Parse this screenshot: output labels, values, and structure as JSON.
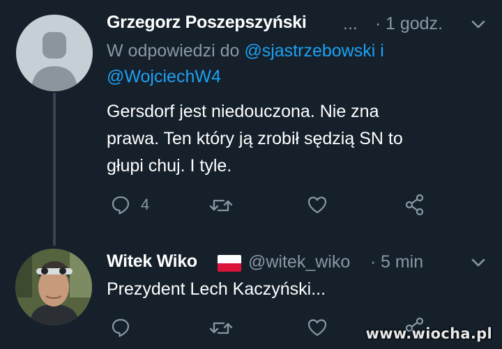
{
  "tweet1": {
    "author_name": "Grzegorz Poszepszyński",
    "ellipsis": "...",
    "dot": "·",
    "time": "1 godz.",
    "reply_prefix": "W odpowiedzi do",
    "mention1": "@sjastrzebowski",
    "conj": "i",
    "mention2": "@WojciechW4",
    "text_line1": "Gersdorf jest niedouczona. Nie zna",
    "text_line2": "prawa. Ten który ją zrobił sędzią SN to",
    "text_line3": "głupi chuj. I tyle.",
    "reply_count": "4"
  },
  "tweet2": {
    "author_name": "Witek Wiko",
    "handle": "@witek_wiko",
    "dot": "·",
    "time": "5 min",
    "text": "Prezydent Lech Kaczyński..."
  },
  "watermark": "www.wiocha.pl",
  "colors": {
    "background": "#15202b",
    "muted": "#8899a6",
    "link": "#1da1f2",
    "thread_line": "#38444d"
  },
  "icons": [
    "reply-icon",
    "retweet-icon",
    "like-icon",
    "share-icon",
    "chevron-down-icon",
    "poland-flag-icon"
  ]
}
